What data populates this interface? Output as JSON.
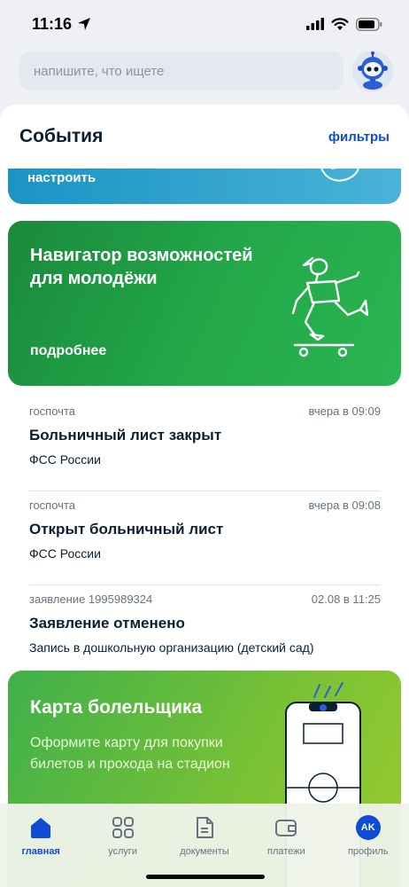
{
  "status_bar": {
    "time": "11:16"
  },
  "search": {
    "placeholder": "напишите, что ищете"
  },
  "sheet": {
    "title": "События",
    "filters_label": "фильтры"
  },
  "teaser": {
    "label": "настроить"
  },
  "youth_banner": {
    "title": "Навигатор возможностей для молодёжи",
    "link": "подробнее"
  },
  "events": [
    {
      "source": "госпочта",
      "time": "вчера в 09:09",
      "title": "Больничный лист закрыт",
      "subtitle": "ФСС России"
    },
    {
      "source": "госпочта",
      "time": "вчера в 09:08",
      "title": "Открыт больничный лист",
      "subtitle": "ФСС России"
    },
    {
      "source": "заявление 1995989324",
      "time": "02.08 в 11:25",
      "title": "Заявление отменено",
      "subtitle": "Запись в дошкольную организацию (детский сад)"
    }
  ],
  "fan_banner": {
    "title": "Карта болельщика",
    "text": "Оформите карту для покупки билетов и прохода на стадион"
  },
  "tabbar": {
    "items": [
      {
        "label": "главная",
        "icon": "home-icon",
        "active": true
      },
      {
        "label": "услуги",
        "icon": "grid-icon"
      },
      {
        "label": "документы",
        "icon": "document-icon"
      },
      {
        "label": "платежи",
        "icon": "wallet-icon"
      },
      {
        "label": "профиль",
        "icon": "avatar",
        "initials": "AK"
      }
    ]
  },
  "colors": {
    "accent": "#0d4cd3",
    "green": "#23a94a",
    "teal": "#1a94c4",
    "lime": "#7cc234"
  }
}
